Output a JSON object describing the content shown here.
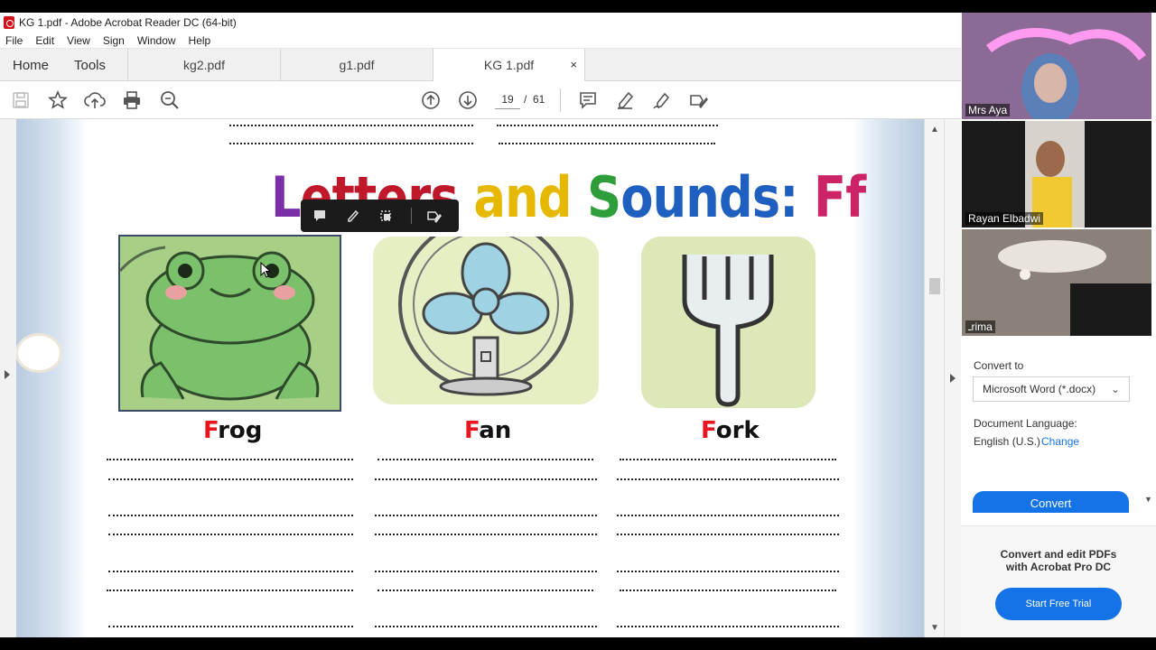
{
  "window": {
    "title": "KG 1.pdf - Adobe Acrobat Reader DC (64-bit)"
  },
  "menu": [
    "File",
    "Edit",
    "View",
    "Sign",
    "Window",
    "Help"
  ],
  "tabs": {
    "home": "Home",
    "tools": "Tools",
    "docs": [
      {
        "label": "kg2.pdf"
      },
      {
        "label": "g1.pdf"
      },
      {
        "label": "KG 1.pdf",
        "close": "×"
      }
    ]
  },
  "toolbar": {
    "page_current": "19",
    "page_sep": "/",
    "page_total": "61"
  },
  "document": {
    "title_parts": [
      "L",
      "etters",
      " and ",
      "S",
      "ounds: ",
      "Ff"
    ],
    "words": [
      {
        "first": "F",
        "rest": "rog"
      },
      {
        "first": "F",
        "rest": "an"
      },
      {
        "first": "F",
        "rest": "ork"
      }
    ]
  },
  "participants": [
    {
      "name": "Mrs Aya"
    },
    {
      "name": "Rayan Elbadwi"
    },
    {
      "name": "ـrima"
    }
  ],
  "panel": {
    "convert_to_label": "Convert to",
    "convert_format": "Microsoft Word (*.docx)",
    "doc_lang_label": "Document Language:",
    "doc_lang_value": "English (U.S.)",
    "change_link": "Change",
    "convert_button": "Convert",
    "promo_line1": "Convert and edit PDFs",
    "promo_line2": "with Acrobat Pro DC",
    "trial_button": "Start Free Trial"
  },
  "colors": {
    "accent": "#1473e6",
    "letter_red": "#e8141e"
  }
}
